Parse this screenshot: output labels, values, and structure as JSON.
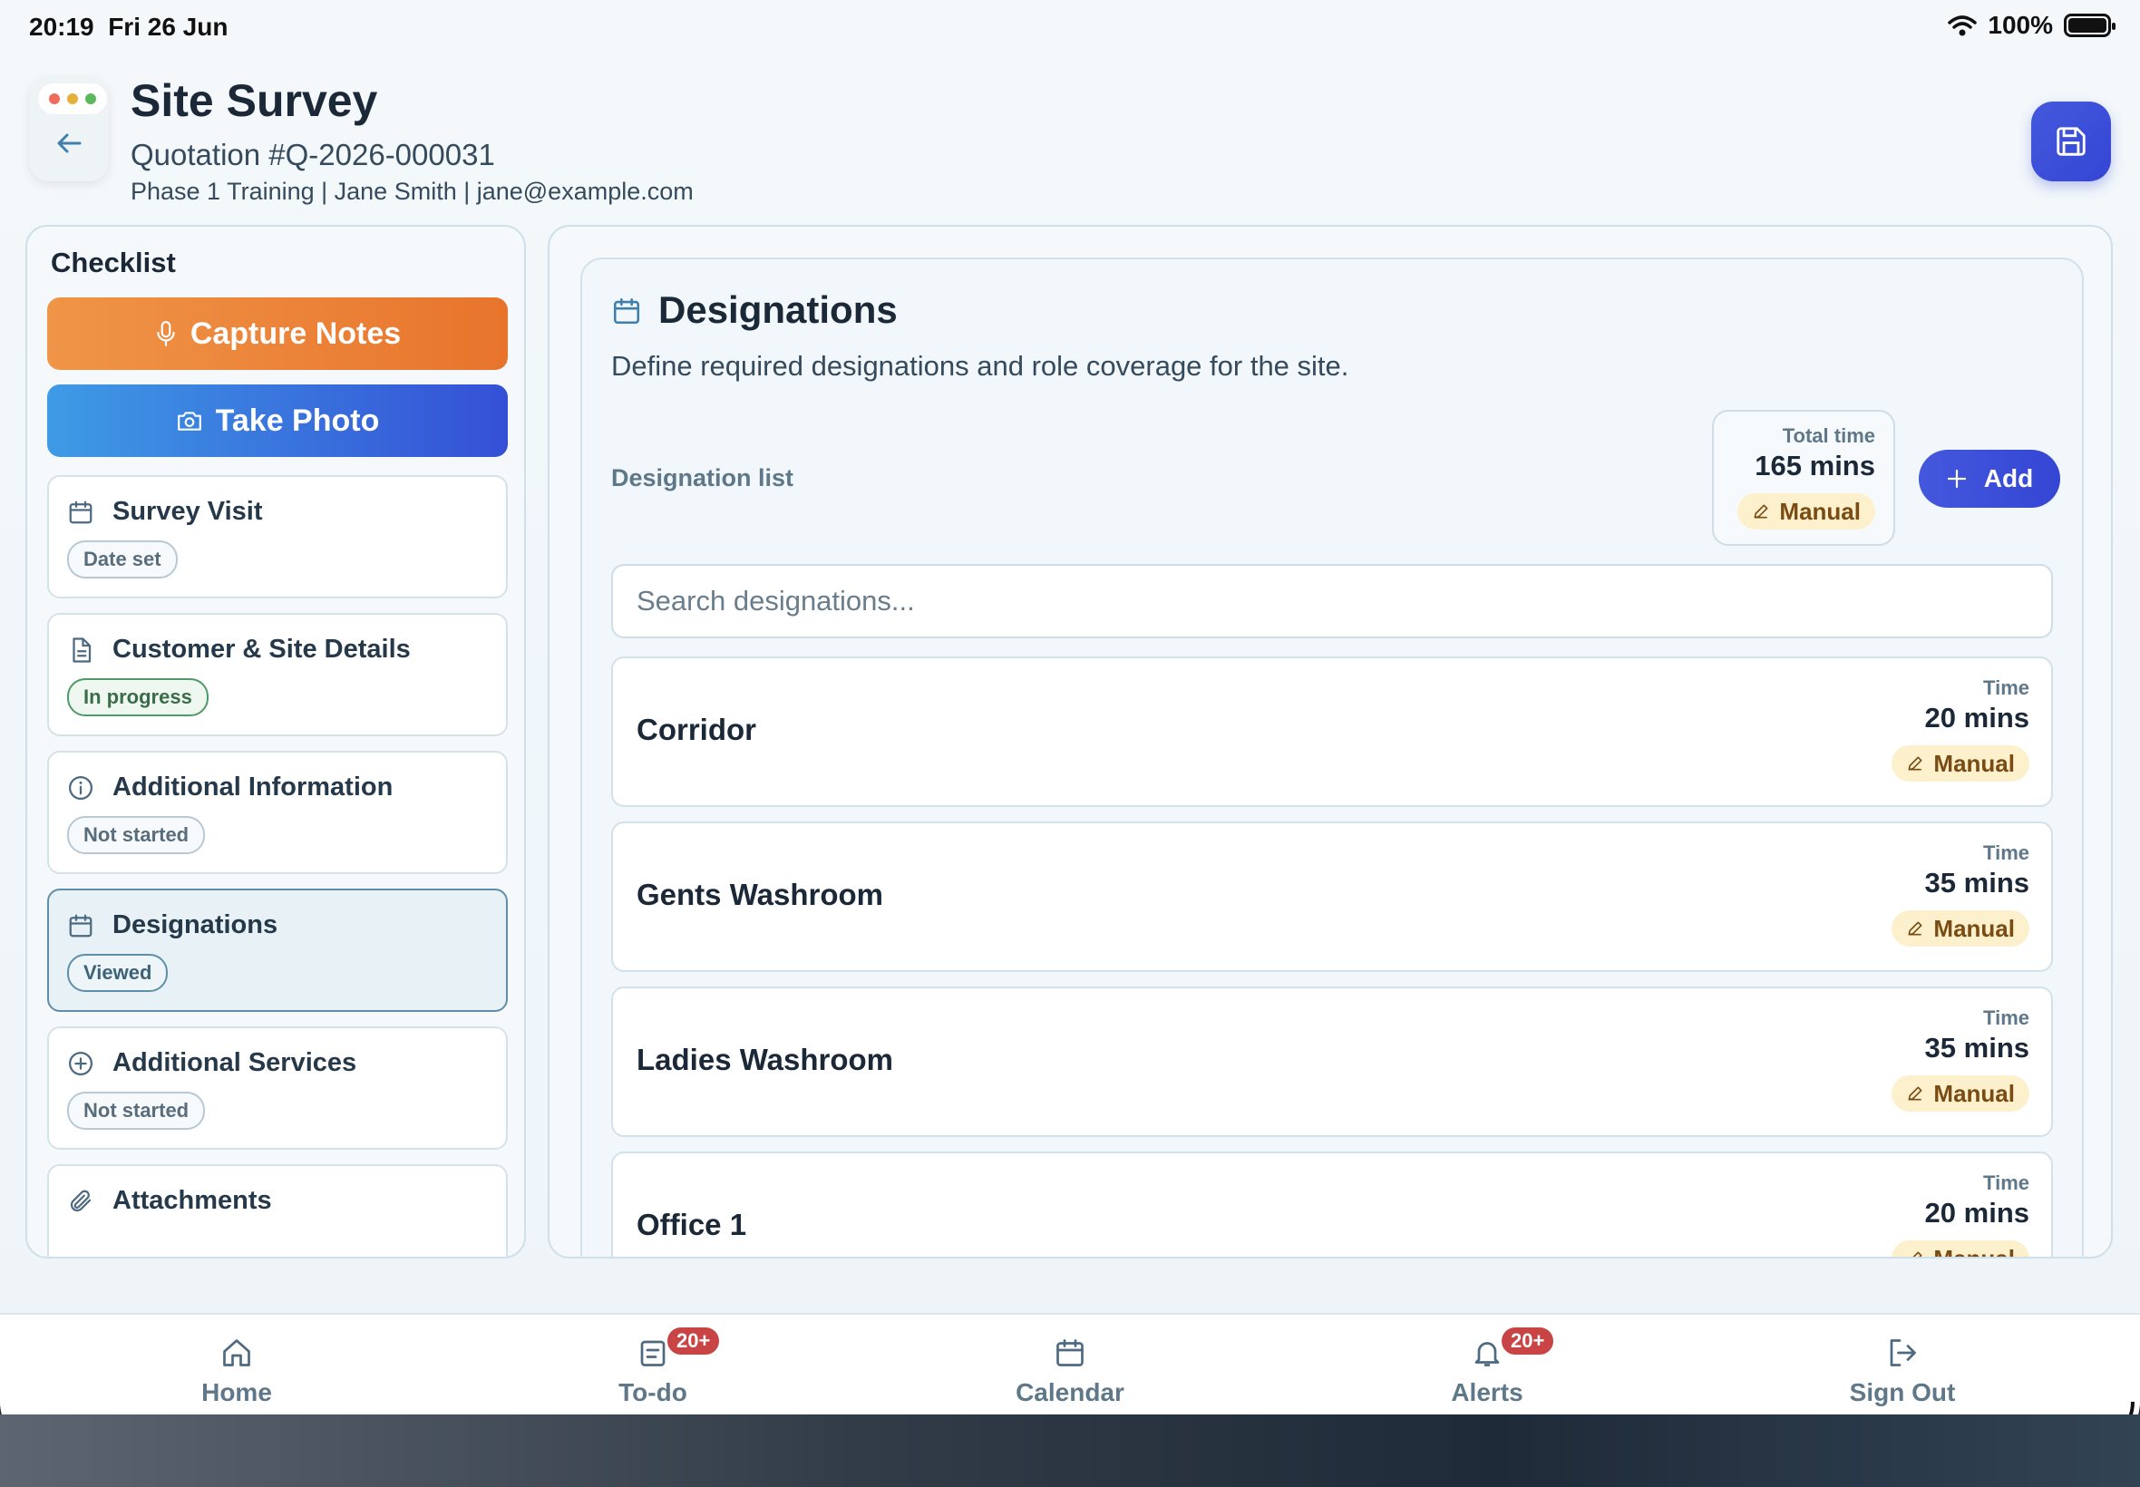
{
  "status_bar": {
    "time": "20:19",
    "date": "Fri 26 Jun",
    "battery": "100%"
  },
  "header": {
    "title": "Site Survey",
    "quotation": "Quotation #Q-2026-000031",
    "meta": "Phase 1 Training | Jane Smith | jane@example.com"
  },
  "checklist": {
    "title": "Checklist",
    "capture_notes": "Capture Notes",
    "take_photo": "Take Photo",
    "items": [
      {
        "label": "Survey Visit",
        "status": "Date set",
        "icon": "calendar-icon"
      },
      {
        "label": "Customer & Site Details",
        "status": "In progress",
        "icon": "document-icon"
      },
      {
        "label": "Additional Information",
        "status": "Not started",
        "icon": "info-icon"
      },
      {
        "label": "Designations",
        "status": "Viewed",
        "icon": "calendar-icon"
      },
      {
        "label": "Additional Services",
        "status": "Not started",
        "icon": "plus-circle-icon"
      },
      {
        "label": "Attachments",
        "status": "",
        "icon": "paperclip-icon"
      }
    ]
  },
  "designations": {
    "title": "Designations",
    "description": "Define required designations and role coverage for the site.",
    "list_label": "Designation list",
    "total_label": "Total time",
    "total_value": "165 mins",
    "total_mode": "Manual",
    "add_label": "Add",
    "search_placeholder": "Search designations...",
    "time_label": "Time",
    "rows": [
      {
        "name": "Corridor",
        "time": "20 mins",
        "mode": "Manual"
      },
      {
        "name": "Gents Washroom",
        "time": "35 mins",
        "mode": "Manual"
      },
      {
        "name": "Ladies Washroom",
        "time": "35 mins",
        "mode": "Manual"
      },
      {
        "name": "Office 1",
        "time": "20 mins",
        "mode": "Manual"
      }
    ]
  },
  "nav": {
    "items": [
      {
        "label": "Home",
        "icon": "home-icon",
        "badge": ""
      },
      {
        "label": "To-do",
        "icon": "todo-icon",
        "badge": "20+"
      },
      {
        "label": "Calendar",
        "icon": "calendar-icon",
        "badge": ""
      },
      {
        "label": "Alerts",
        "icon": "bell-icon",
        "badge": "20+"
      },
      {
        "label": "Sign Out",
        "icon": "sign-out-icon",
        "badge": ""
      }
    ]
  },
  "colors": {
    "accent": "#3446d4",
    "orange": "#e8742c",
    "manual_chip": "#fdf0cc",
    "badge_red": "#c94545"
  }
}
